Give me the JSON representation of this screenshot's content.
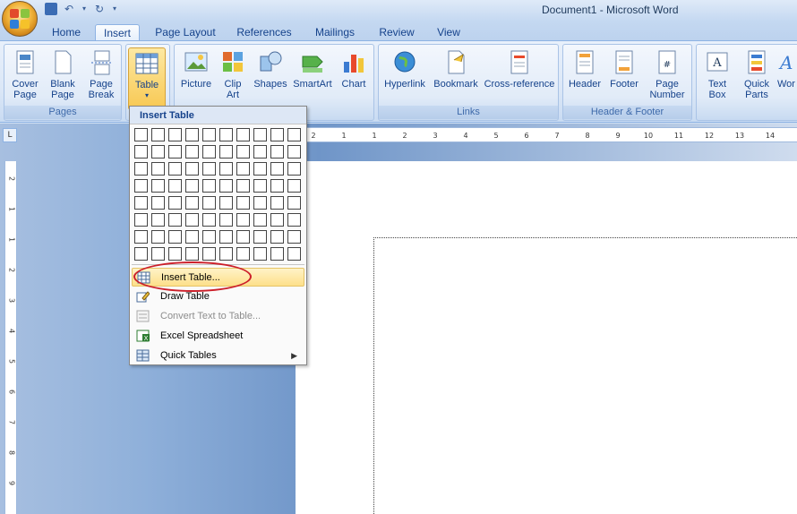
{
  "window": {
    "title": "Document1 - Microsoft Word"
  },
  "tabs": [
    "Home",
    "Insert",
    "Page Layout",
    "References",
    "Mailings",
    "Review",
    "View"
  ],
  "active_tab": "Insert",
  "ribbon": {
    "pages_group": {
      "label": "Pages",
      "cover_page": "Cover\nPage",
      "blank_page": "Blank\nPage",
      "page_break": "Page\nBreak"
    },
    "table": "Table",
    "illustrations": {
      "picture": "Picture",
      "clip_art": "Clip\nArt",
      "shapes": "Shapes",
      "smartart": "SmartArt",
      "chart": "Chart"
    },
    "links_group": {
      "label": "Links",
      "hyperlink": "Hyperlink",
      "bookmark": "Bookmark",
      "cross_reference": "Cross-reference"
    },
    "header_footer_group": {
      "label": "Header & Footer",
      "header": "Header",
      "footer": "Footer",
      "page_number": "Page\nNumber"
    },
    "text_group": {
      "text_box": "Text\nBox",
      "quick_parts": "Quick\nParts",
      "wordart": "Wor"
    }
  },
  "dropdown": {
    "title": "Insert Table",
    "grid": {
      "columns": 10,
      "rows": 8
    },
    "items": [
      {
        "label": "Insert Table...",
        "highlighted": true,
        "icon": "insert-table-icon"
      },
      {
        "label": "Draw Table",
        "icon": "pencil-icon"
      },
      {
        "label": "Convert Text to Table...",
        "disabled": true,
        "icon": "convert-icon"
      },
      {
        "label": "Excel Spreadsheet",
        "icon": "excel-icon"
      },
      {
        "label": "Quick Tables",
        "submenu": true,
        "icon": "quick-tables-icon"
      }
    ]
  },
  "ruler": {
    "horizontal_ticks": [
      "2",
      "1",
      "1",
      "2",
      "3",
      "4",
      "5",
      "6",
      "7",
      "8",
      "9",
      "10",
      "11",
      "12",
      "13",
      "14"
    ],
    "vertical_ticks": [
      "2",
      "1",
      "1",
      "2",
      "3",
      "4",
      "5",
      "6",
      "7",
      "8",
      "9"
    ]
  },
  "colors": {
    "accent": "#15428b",
    "highlight": "#fde08a",
    "annotation": "#cc1f2a"
  }
}
